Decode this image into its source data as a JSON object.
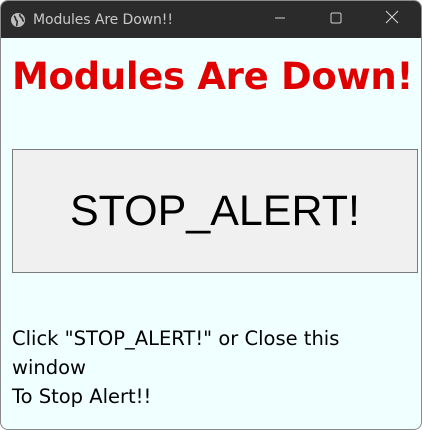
{
  "window": {
    "title": "Modules Are Down!!",
    "icon": "globe-icon",
    "controls": {
      "minimize": "minimize-icon",
      "maximize": "maximize-icon",
      "close": "close-icon"
    }
  },
  "main": {
    "heading": "Modules Are Down!",
    "stop_button_label": "STOP_ALERT!",
    "message_line1": "Click \"STOP_ALERT!\" or Close this window",
    "message_line2": "To Stop Alert!!"
  },
  "colors": {
    "window_background": "#f0ffff",
    "heading": "#e00000",
    "titlebar": "#2b2b2b"
  }
}
